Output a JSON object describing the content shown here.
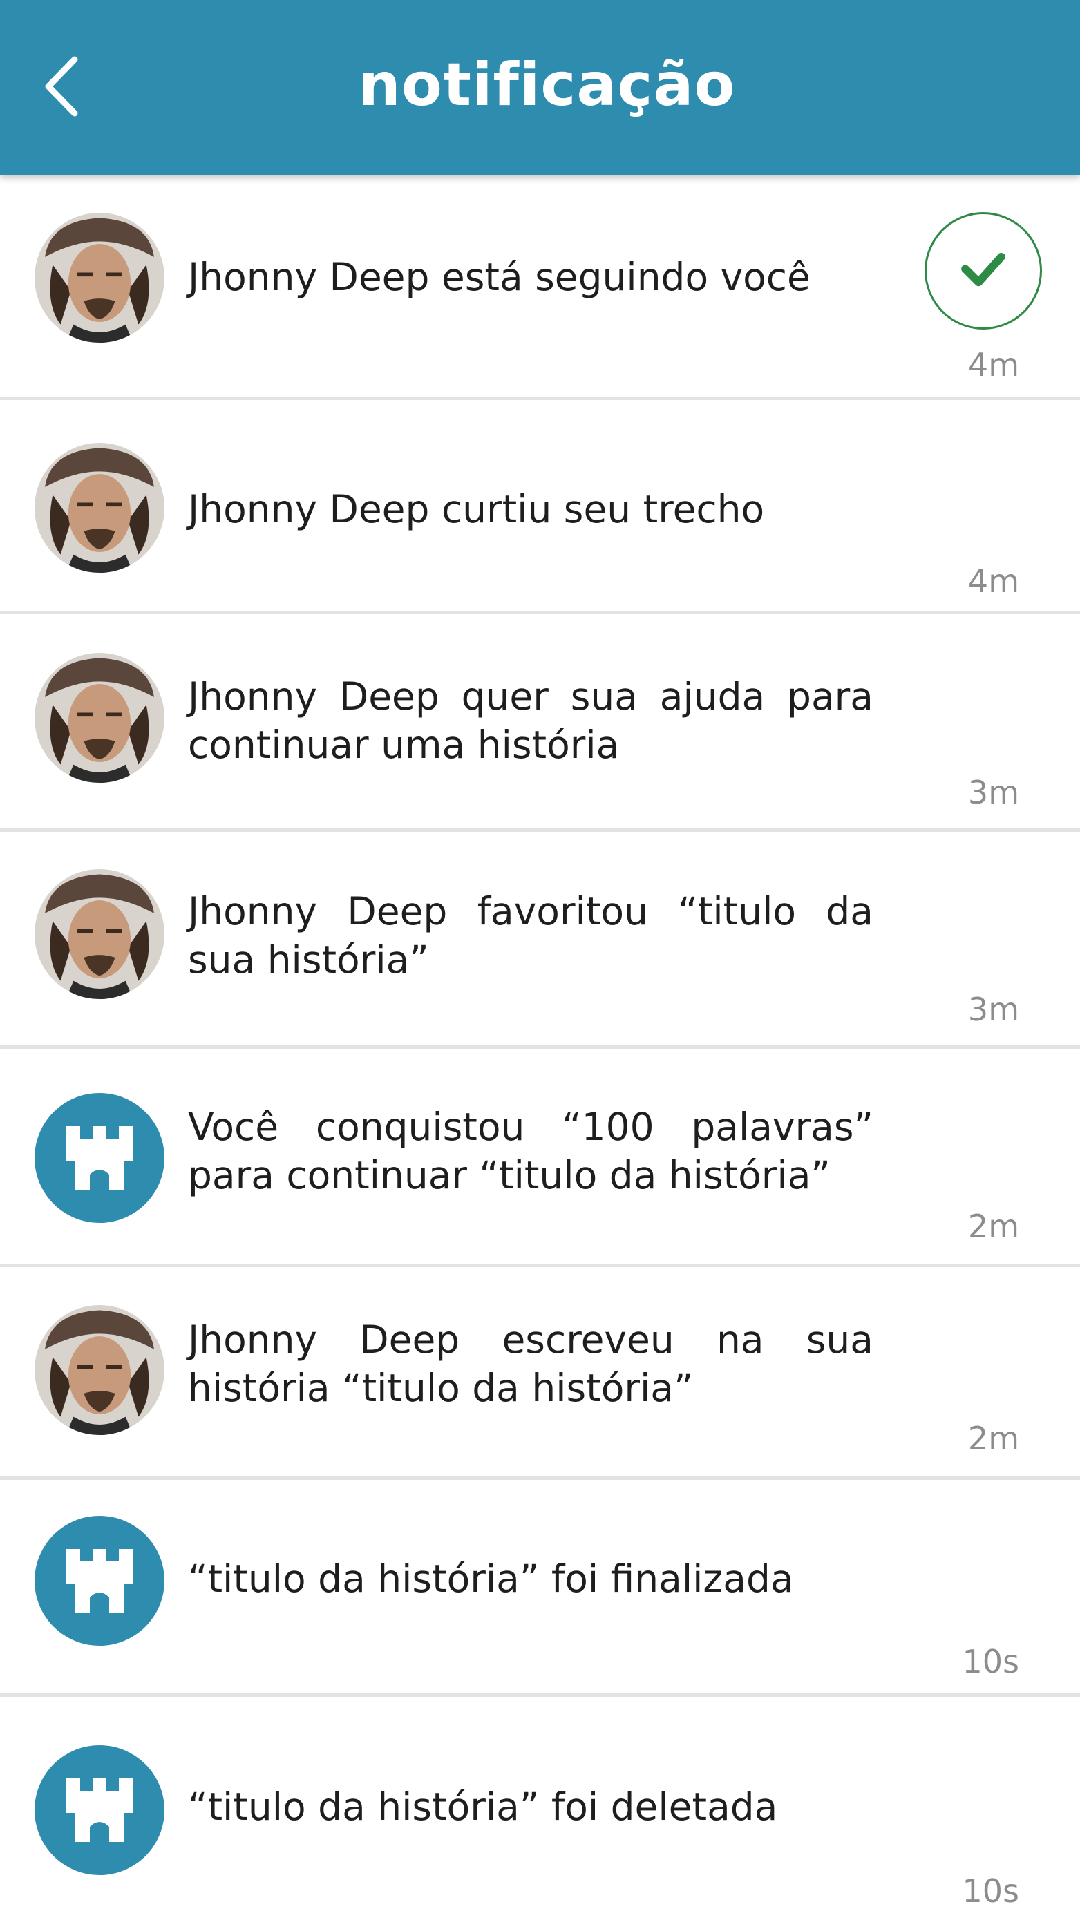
{
  "header": {
    "title": "notificação"
  },
  "colors": {
    "accent": "#2e8cae",
    "check": "#2e8b46",
    "timestamp": "#8c8c8c",
    "divider": "#e3e3e3"
  },
  "notifications": [
    {
      "icon": "user-avatar",
      "text": "Jhonny Deep está seguindo você",
      "time": "4m",
      "action": "check-icon"
    },
    {
      "icon": "user-avatar",
      "text": "Jhonny Deep curtiu seu trecho",
      "time": "4m"
    },
    {
      "icon": "user-avatar",
      "text": "Jhonny Deep quer sua ajuda para continuar uma história",
      "time": "3m"
    },
    {
      "icon": "user-avatar",
      "text": "Jhonny Deep favoritou “titulo da sua história”",
      "time": "3m"
    },
    {
      "icon": "castle-icon",
      "text": "Você conquistou “100 palavras” para continuar “titulo da história”",
      "time": "2m"
    },
    {
      "icon": "user-avatar",
      "text": "Jhonny Deep escreveu na sua história “titulo da história”",
      "time": "2m"
    },
    {
      "icon": "castle-icon",
      "text": "“titulo da história” foi finalizada",
      "time": "10s"
    },
    {
      "icon": "castle-icon",
      "text": "“titulo da história” foi deletada",
      "time": "10s"
    }
  ]
}
